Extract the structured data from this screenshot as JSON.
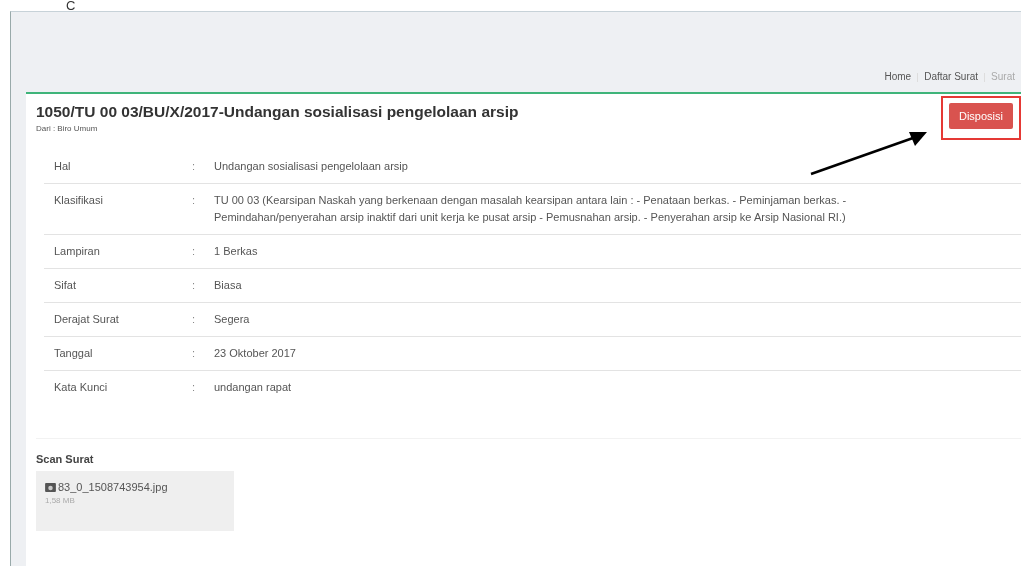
{
  "top_letter": "C",
  "breadcrumb": [
    {
      "label": "Home",
      "selected": false
    },
    {
      "label": "Daftar Surat",
      "selected": false
    },
    {
      "label": "Surat",
      "selected": true
    }
  ],
  "letter": {
    "title": "1050/TU 00 03/BU/X/2017-Undangan sosialisasi pengelolaan arsip",
    "from": "Dari : Biro Umum",
    "action_button": "Disposisi",
    "fields": [
      {
        "label": "Hal",
        "value": "Undangan sosialisasi pengelolaan arsip"
      },
      {
        "label": "Klasifikasi",
        "value": "TU 00 03 (Kearsipan Naskah yang berkenaan dengan masalah kearsipan antara lain : - Penataan berkas. - Peminjaman berkas. - Pemindahan/penyerahan arsip inaktif dari unit kerja ke pusat arsip - Pemusnahan arsip. - Penyerahan arsip ke Arsip Nasional RI.)"
      },
      {
        "label": "Lampiran",
        "value": "1 Berkas"
      },
      {
        "label": "Sifat",
        "value": "Biasa"
      },
      {
        "label": "Derajat Surat",
        "value": "Segera"
      },
      {
        "label": "Tanggal",
        "value": "23 Oktober 2017"
      },
      {
        "label": "Kata Kunci",
        "value": "undangan rapat"
      }
    ],
    "separator": ":",
    "scan": {
      "heading": "Scan Surat",
      "files": [
        {
          "name": "83_0_1508743954.jpg",
          "size": "1,58 MB"
        }
      ]
    }
  }
}
